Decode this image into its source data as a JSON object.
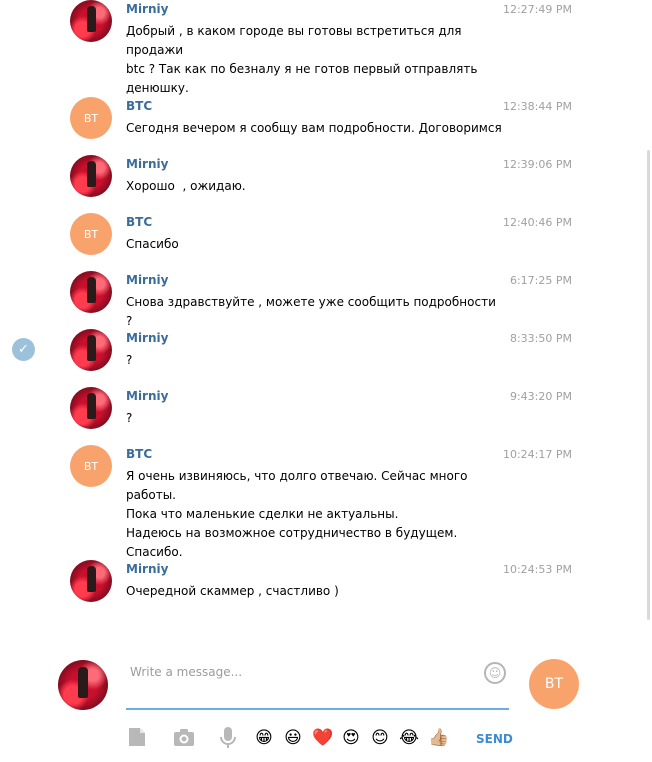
{
  "messages": [
    {
      "sender": "Mirniy",
      "time": "12:27:49 PM",
      "text": [
        "Добрый , в каком городе вы готовы встретиться для продажи",
        "btc ? Так как по безналу я не готов первый отправлять",
        "денюшку."
      ]
    },
    {
      "sender": "BTC",
      "time": "12:38:44 PM",
      "text": [
        "Сегодня вечером я сообщу вам подробности. Договоримся"
      ]
    },
    {
      "sender": "Mirniy",
      "time": "12:39:06 PM",
      "text": [
        "Хорошо  , ожидаю."
      ]
    },
    {
      "sender": "BTC",
      "time": "12:40:46 PM",
      "text": [
        "Спасибо"
      ]
    },
    {
      "sender": "Mirniy",
      "time": "6:17:25 PM",
      "text": [
        "Снова здравствуйте , можете уже сообщить подробности ?"
      ]
    },
    {
      "sender": "Mirniy",
      "time": "8:33:50 PM",
      "text": [
        "?"
      ]
    },
    {
      "sender": "Mirniy",
      "time": "9:43:20 PM",
      "text": [
        "?"
      ]
    },
    {
      "sender": "BTC",
      "time": "10:24:17 PM",
      "text": [
        "Я очень извиняюсь, что долго отвечаю. Сейчас много работы.",
        "Пока что маленькие сделки не актуальны.",
        "Надеюсь на возможное сотрудничество в будущем.",
        "Спасибо."
      ]
    },
    {
      "sender": "Mirniy",
      "time": "10:24:53 PM",
      "text": [
        "Очередной скаммер , счастливо )"
      ]
    }
  ],
  "avatars": {
    "btc_initials": "BT"
  },
  "composer": {
    "placeholder": "Write a message...",
    "send_label": "SEND",
    "peer_initials": "BT",
    "emojis": [
      "😁",
      "😃",
      "❤️",
      "😍",
      "😊",
      "😂",
      "👍🏼"
    ]
  },
  "colors": {
    "accent": "#3d8bd0",
    "name": "#3a6d99",
    "btc_avatar": "#f9a36c",
    "input_underline": "#6aaee3"
  }
}
